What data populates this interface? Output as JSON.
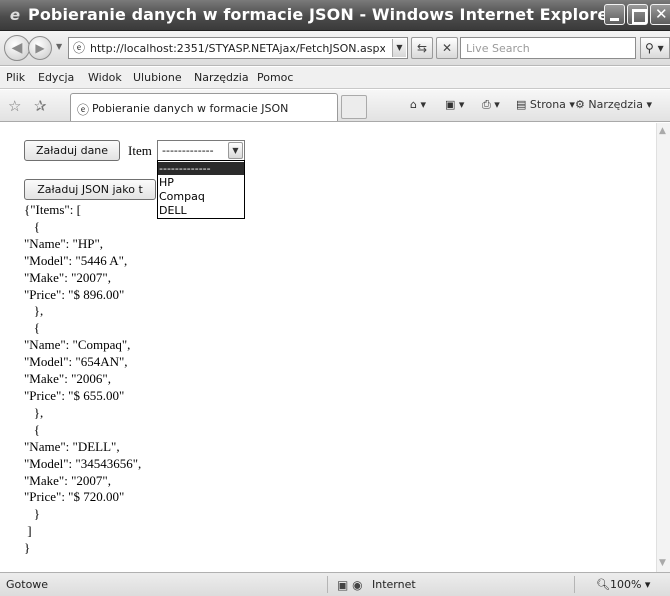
{
  "window": {
    "title": "Pobieranie danych w formacie JSON - Windows Internet Explorer"
  },
  "address_bar": {
    "url": "http://localhost:2351/STYASP.NETAjax/FetchJSON.aspx",
    "search_placeholder": "Live Search"
  },
  "menu": {
    "items": [
      "Plik",
      "Edycja",
      "Widok",
      "Ulubione",
      "Narzędzia",
      "Pomoc"
    ]
  },
  "tab": {
    "label": "Pobieranie danych w formacie JSON"
  },
  "commands": {
    "page_label": "Strona",
    "tools_label": "Narzędzia"
  },
  "page": {
    "load_data_button": "Załaduj dane",
    "item_label": "Item",
    "select_value": "-------------",
    "dropdown_options": [
      "-------------",
      "HP",
      "Compaq",
      "DELL"
    ],
    "load_json_button": "Załaduj JSON jako t",
    "json_lines": [
      "{\"Items\": [",
      "   {",
      "\"Name\": \"HP\",",
      "\"Model\": \"5446 A\",",
      "\"Make\": \"2007\",",
      "\"Price\": \"$ 896.00\"",
      "   },",
      "   {",
      "\"Name\": \"Compaq\",",
      "\"Model\": \"654AN\",",
      "\"Make\": \"2006\",",
      "\"Price\": \"$ 655.00\"",
      "   },",
      "   {",
      "\"Name\": \"DELL\",",
      "\"Model\": \"34543656\",",
      "\"Make\": \"2007\",",
      "\"Price\": \"$ 720.00\"",
      "   }",
      " ]",
      "}"
    ]
  },
  "status": {
    "text": "Gotowe",
    "zone": "Internet",
    "zoom": "100%"
  }
}
